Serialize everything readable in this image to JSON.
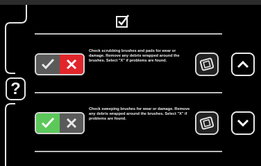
{
  "help": {
    "label": "?"
  },
  "checklist": {
    "header_icon": "checkbox-checked-icon",
    "items": [
      {
        "text": "Check scrubbing brushes and pads for wear or damage. Remove any debris wrapped around the brushes. Select \"X\" if problems are found.",
        "selected": "fail",
        "arrow": "up"
      },
      {
        "text": "Check sweeping brushes for wear or damage. Remove any debris wrapped around the brushes. Select \"X\" if problems are found.",
        "selected": "pass",
        "arrow": "down"
      }
    ]
  },
  "colors": {
    "pass_active": "#5cc85a",
    "fail_active": "#e0262b",
    "inactive": "#5a5a5a",
    "border": "#d5d5d5"
  }
}
